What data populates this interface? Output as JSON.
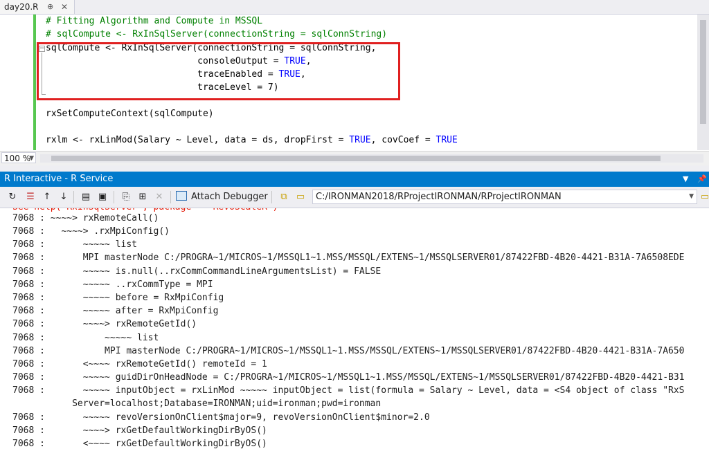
{
  "editor_tab": {
    "title": "day20.R",
    "pin": "⊕",
    "close": "✕"
  },
  "editor": {
    "lines": [
      "# Fitting Algorithm and Compute in MSSQL",
      "# sqlCompute <- RxInSqlServer(connectionString = sqlConnString)",
      "sqlCompute <- RxInSqlServer(connectionString = sqlConnString,",
      "                            consoleOutput = ",
      "                            traceEnabled = ",
      "                            traceLevel = 7)",
      "",
      "rxSetComputeContext(sqlCompute)",
      "",
      "rxlm <- rxLinMod(Salary ~ Level, data = ds, dropFirst = ",
      ", covCoef = "
    ],
    "kw_true": "TRUE",
    "kw_comma": ","
  },
  "zoom": {
    "value": "100 %"
  },
  "tool_window": {
    "title": "R Interactive - R Service",
    "attach_label": "Attach Debugger",
    "path": "C:/IRONMAN2018/RProjectIRONMAN/RProjectIRONMAN"
  },
  "console": {
    "lines": [
      "See help('RxInSqlServer', package = 'RevoScaleR')",
      "7068 : ~~~~> rxRemoteCall()",
      "7068 :   ~~~~> .rxMpiConfig()",
      "7068 :       ~~~~~ list",
      "7068 :       MPI masterNode C:/PROGRA~1/MICROS~1/MSSQL1~1.MSS/MSSQL/EXTENS~1/MSSQLSERVER01/87422FBD-4B20-4421-B31A-7A6508EDE",
      "7068 :       ~~~~~ is.null(..rxCommCommandLineArgumentsList) = FALSE",
      "7068 :       ~~~~~ ..rxCommType = MPI",
      "7068 :       ~~~~~ before = RxMpiConfig",
      "7068 :       ~~~~~ after = RxMpiConfig",
      "7068 :       ~~~~> rxRemoteGetId()",
      "7068 :           ~~~~~ list",
      "7068 :           MPI masterNode C:/PROGRA~1/MICROS~1/MSSQL1~1.MSS/MSSQL/EXTENS~1/MSSQLSERVER01/87422FBD-4B20-4421-B31A-7A650",
      "7068 :       <~~~~ rxRemoteGetId() remoteId = 1",
      "7068 :       ~~~~~ guidDirOnHeadNode = C:/PROGRA~1/MICROS~1/MSSQL1~1.MSS/MSSQL/EXTENS~1/MSSQLSERVER01/87422FBD-4B20-4421-B31",
      "7068 :       ~~~~~ inputObject = rxLinMod ~~~~~ inputObject = list(formula = Salary ~ Level, data = <S4 object of class \"RxS",
      "           Server=localhost;Database=IRONMAN;uid=ironman;pwd=ironman",
      "7068 :       ~~~~~ revoVersionOnClient$major=9, revoVersionOnClient$minor=2.0",
      "7068 :       ~~~~> rxGetDefaultWorkingDirByOS()",
      "7068 :       <~~~~ rxGetDefaultWorkingDirByOS()"
    ]
  }
}
